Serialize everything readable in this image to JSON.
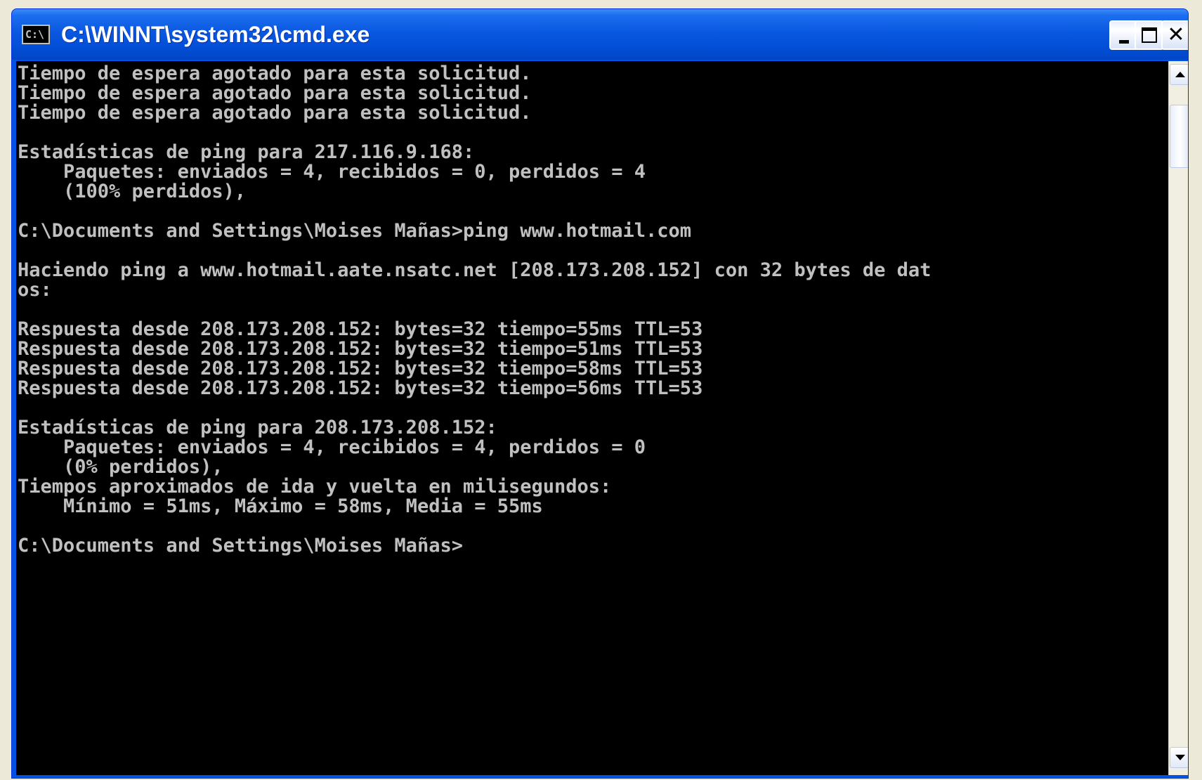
{
  "window": {
    "title": "C:\\WINNT\\system32\\cmd.exe",
    "icon_label": "C:\\",
    "icon": "console-app-icon",
    "controls": {
      "minimize": "minimize-icon",
      "maximize": "maximize-icon",
      "close_glyph": "✕"
    }
  },
  "console": {
    "foreground": "#c0c0c0",
    "background": "#000000",
    "lines": [
      "Tiempo de espera agotado para esta solicitud.",
      "Tiempo de espera agotado para esta solicitud.",
      "Tiempo de espera agotado para esta solicitud.",
      "",
      "Estadísticas de ping para 217.116.9.168:",
      "    Paquetes: enviados = 4, recibidos = 0, perdidos = 4",
      "    (100% perdidos),",
      "",
      "C:\\Documents and Settings\\Moises Mañas>ping www.hotmail.com",
      "",
      "Haciendo ping a www.hotmail.aate.nsatc.net [208.173.208.152] con 32 bytes de dat",
      "os:",
      "",
      "Respuesta desde 208.173.208.152: bytes=32 tiempo=55ms TTL=53",
      "Respuesta desde 208.173.208.152: bytes=32 tiempo=51ms TTL=53",
      "Respuesta desde 208.173.208.152: bytes=32 tiempo=58ms TTL=53",
      "Respuesta desde 208.173.208.152: bytes=32 tiempo=56ms TTL=53",
      "",
      "Estadísticas de ping para 208.173.208.152:",
      "    Paquetes: enviados = 4, recibidos = 4, perdidos = 0",
      "    (0% perdidos),",
      "Tiempos aproximados de ida y vuelta en milisegundos:",
      "    Mínimo = 51ms, Máximo = 58ms, Media = 55ms",
      "",
      "C:\\Documents and Settings\\Moises Mañas>"
    ]
  },
  "scrollbar": {
    "up_icon": "scroll-up-arrow-icon",
    "down_icon": "scroll-down-arrow-icon"
  }
}
